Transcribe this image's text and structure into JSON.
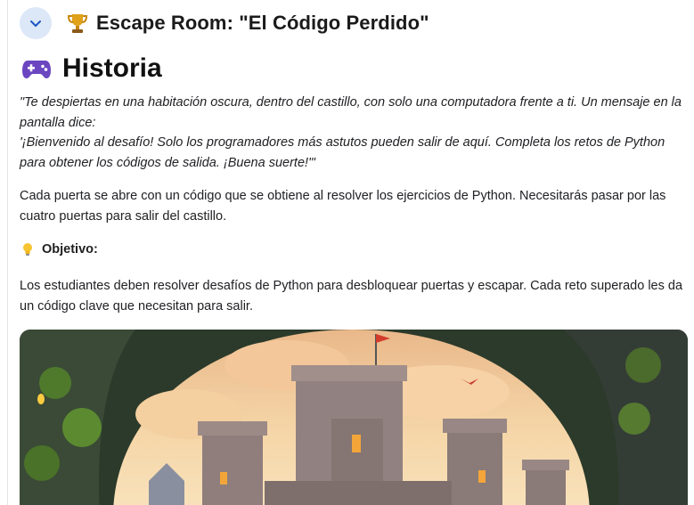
{
  "header": {
    "collapse_icon": "chevron-down-icon",
    "trophy_icon": "trophy-icon",
    "title": "Escape Room: \"El Código Perdido\""
  },
  "section": {
    "icon": "gamepad-icon",
    "heading": "Historia"
  },
  "story": {
    "line1": "\"Te despiertas en una habitación oscura, dentro del castillo,  con solo una computadora frente a ti. Un mensaje en la pantalla dice:",
    "line2": "'¡Bienvenido al desafío! Solo los programadores más astutos pueden salir de aquí. Completa los retos de Python para obtener los códigos de salida. ¡Buena suerte!'\""
  },
  "doors_text": "Cada puerta se abre con un código que se obtiene al resolver los ejercicios de Python. Necesitarás pasar por las cuatro puertas para salir del castillo.",
  "objective": {
    "icon": "lightbulb-icon",
    "label": "Objetivo:",
    "text": "Los estudiantes deben resolver desafíos de Python para desbloquear puertas y escapar. Cada reto superado les da un código clave que necesitan para salir."
  },
  "image": {
    "subject": "castle-illustration"
  },
  "colors": {
    "collapse_bg": "#dce7f7",
    "collapse_icon": "#1a56c4",
    "sky_top": "#f2c28a",
    "stone": "#8a7a78"
  }
}
